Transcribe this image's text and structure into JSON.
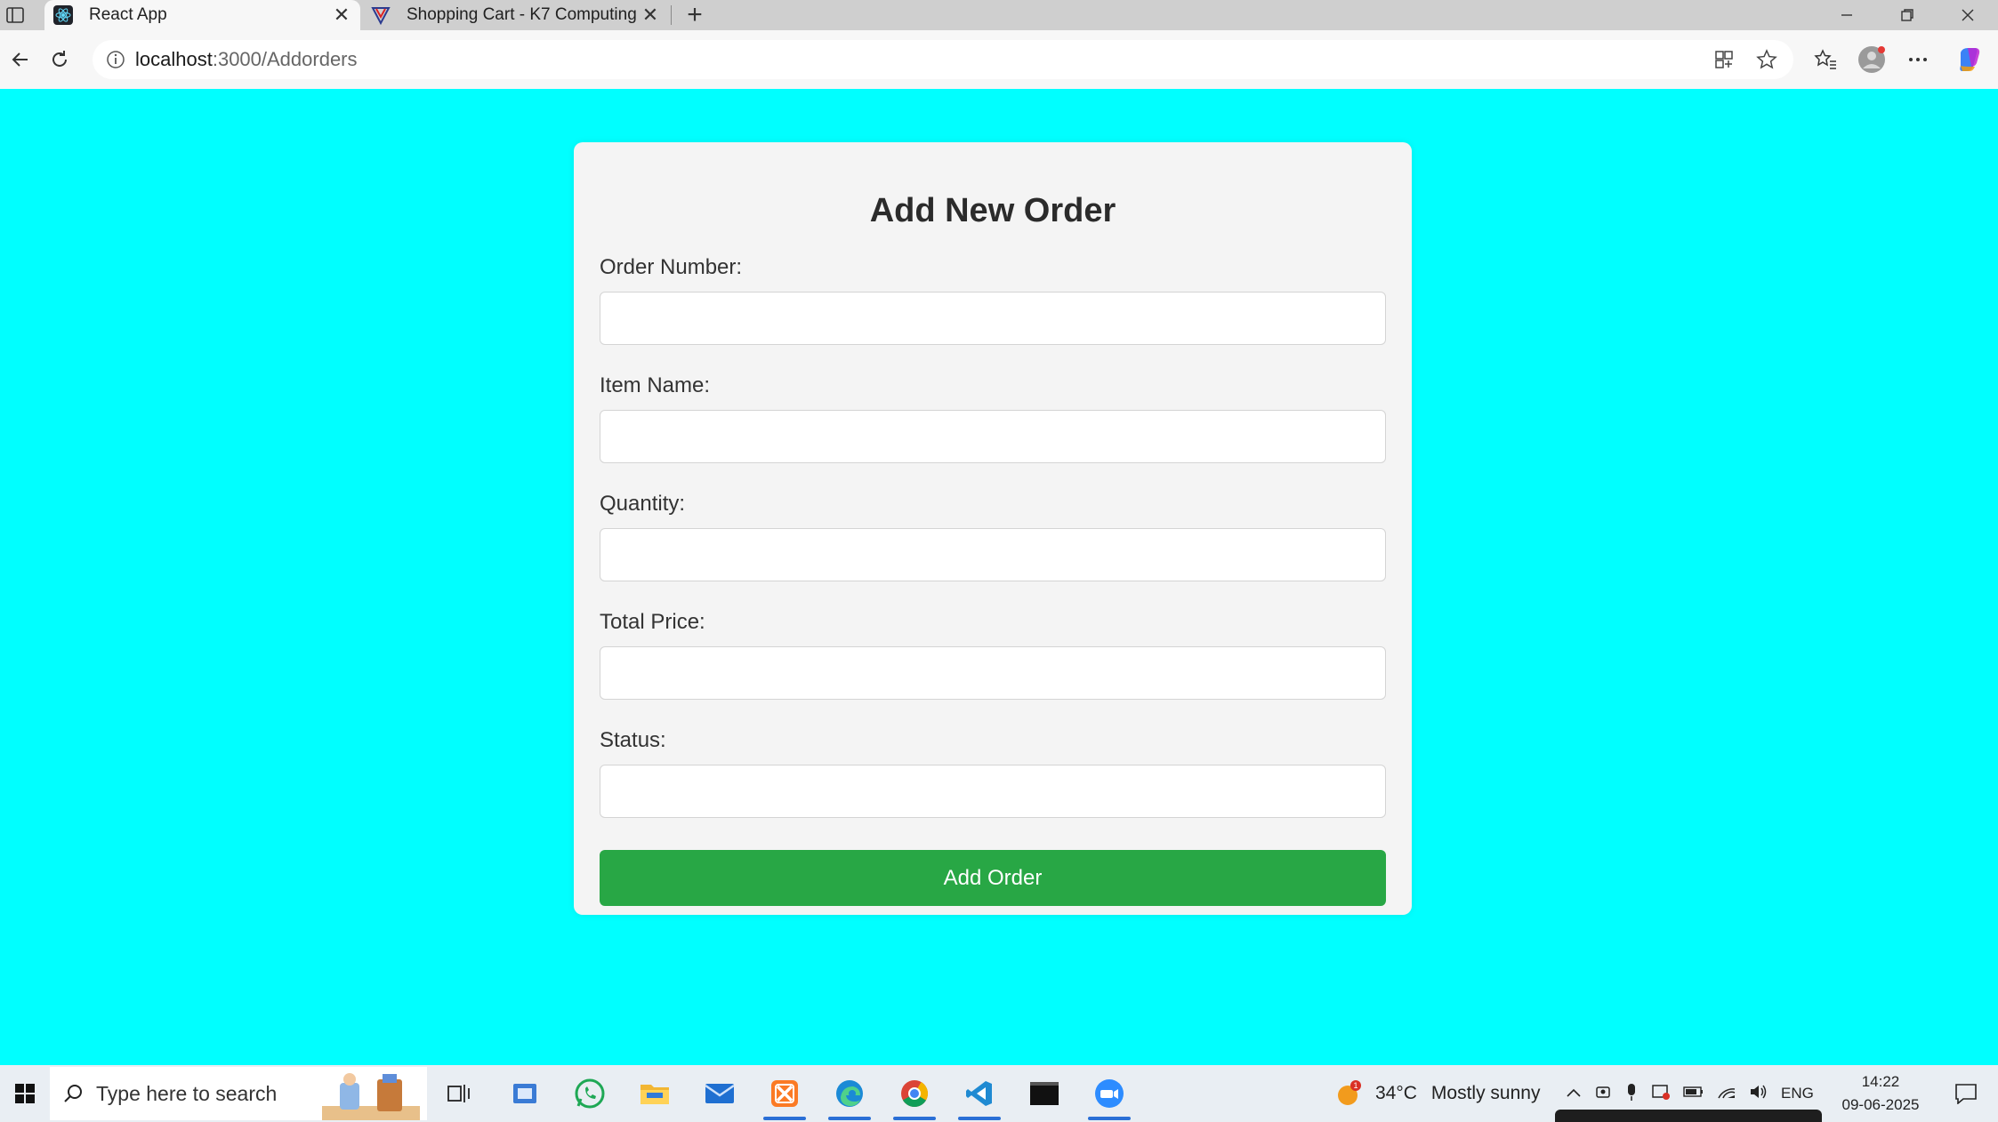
{
  "browser": {
    "tabs": [
      {
        "title": "React App",
        "active": true
      },
      {
        "title": "Shopping Cart - K7 Computing",
        "active": false
      }
    ],
    "address": {
      "host": "localhost",
      "path": ":3000/Addorders"
    }
  },
  "form": {
    "title": "Add New Order",
    "fields": [
      {
        "label": "Order Number:",
        "value": ""
      },
      {
        "label": "Item Name:",
        "value": ""
      },
      {
        "label": "Quantity:",
        "value": ""
      },
      {
        "label": "Total Price:",
        "value": ""
      },
      {
        "label": "Status:",
        "value": ""
      }
    ],
    "submit_label": "Add Order"
  },
  "taskbar": {
    "search_placeholder": "Type here to search",
    "weather": {
      "temp": "34°C",
      "condition": "Mostly sunny"
    },
    "language": "ENG",
    "time": "14:22",
    "date": "09-06-2025"
  },
  "colors": {
    "page_bg": "#00ffff",
    "card_bg": "#f4f4f4",
    "button": "#28a745"
  }
}
